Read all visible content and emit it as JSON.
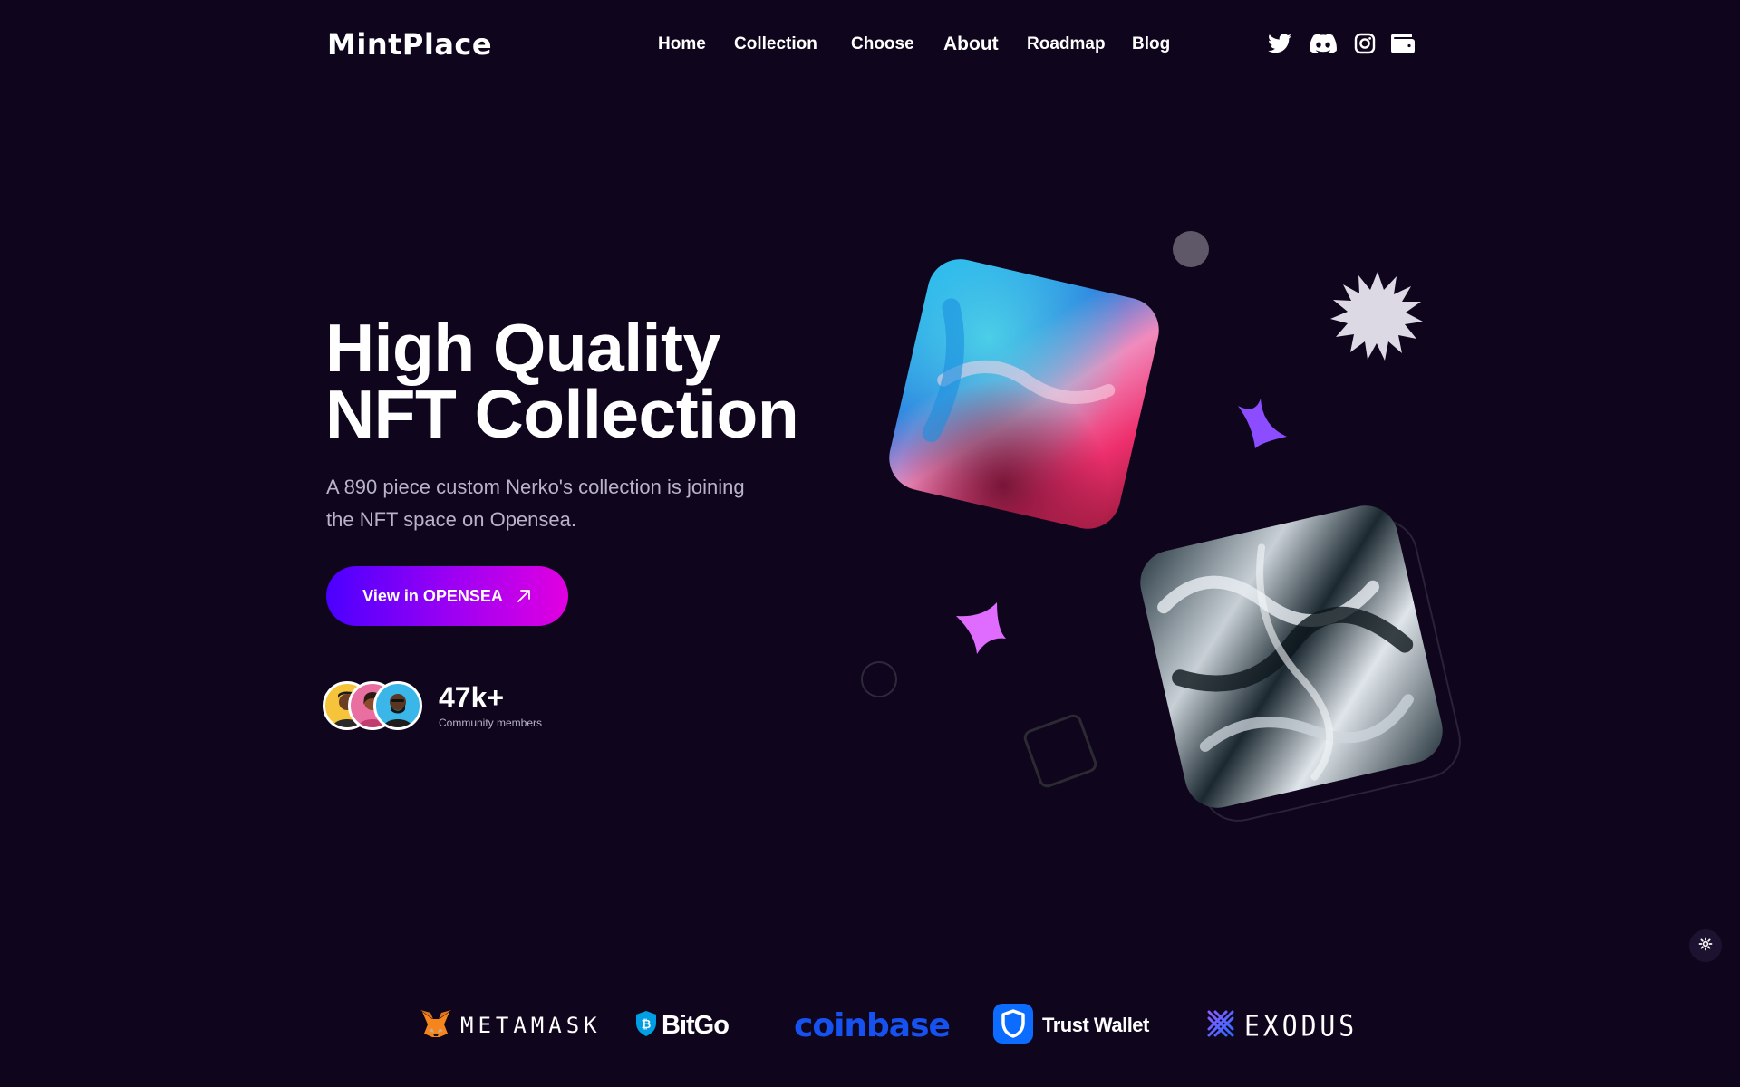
{
  "header": {
    "logo": "MintPlace",
    "nav": [
      {
        "label": "Home"
      },
      {
        "label": "Collection"
      },
      {
        "label": "Choose"
      },
      {
        "label": "About"
      },
      {
        "label": "Roadmap"
      },
      {
        "label": "Blog"
      }
    ],
    "socials": [
      "twitter-icon",
      "discord-icon",
      "instagram-icon",
      "wallet-icon"
    ]
  },
  "hero": {
    "title_line1": "High Quality",
    "title_line2": "NFT Collection",
    "subtitle": "A 890 piece custom Nerko's collection is joining the NFT space on Opensea.",
    "cta_label": "View in OPENSEA",
    "members_count": "47k+",
    "members_label": "Community members"
  },
  "partners": [
    {
      "name": "METAMASK"
    },
    {
      "name": "BitGo"
    },
    {
      "name": "coinbase"
    },
    {
      "name": "Trust Wallet"
    },
    {
      "name": "EXODUS"
    }
  ],
  "colors": {
    "background": "#0f051d",
    "cta_gradient_start": "#4b00ff",
    "cta_gradient_end": "#e100e0",
    "coinbase_blue": "#1652f0",
    "sparkle_purple": "#8b4dff",
    "sparkle_pink": "#e06bff"
  }
}
